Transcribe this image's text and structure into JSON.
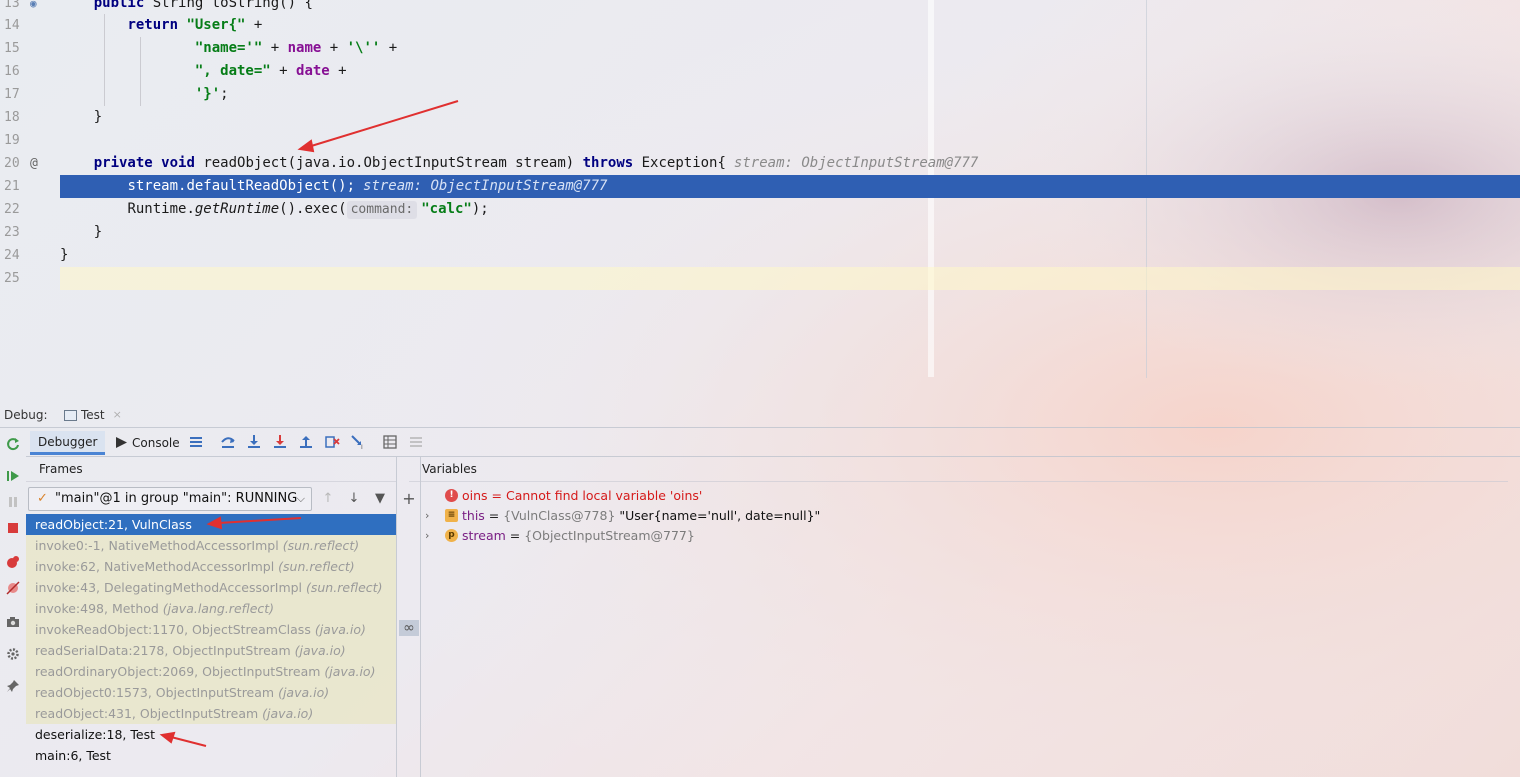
{
  "editor": {
    "lines": [
      {
        "num": "13",
        "mark": "impl"
      },
      {
        "num": "14"
      },
      {
        "num": "15"
      },
      {
        "num": "16"
      },
      {
        "num": "17"
      },
      {
        "num": "18"
      },
      {
        "num": "19"
      },
      {
        "num": "20",
        "mark": "at"
      },
      {
        "num": "21"
      },
      {
        "num": "22"
      },
      {
        "num": "23"
      },
      {
        "num": "24"
      },
      {
        "num": "25"
      }
    ],
    "code": {
      "l13": {
        "kw1": "public",
        "t1": " String ",
        "t2": "toString() {"
      },
      "l14": {
        "kw": "return",
        "str": "\"User{\"",
        "t": " +"
      },
      "l15": {
        "str1": "\"name='\"",
        "t1": " + ",
        "fld": "name",
        "t2": " + ",
        "str2": "'\\''",
        "t3": " +"
      },
      "l16": {
        "str": "\", date=\"",
        "t1": " + ",
        "fld": "date",
        "t2": " +"
      },
      "l17": {
        "str": "'}'",
        "t": ";"
      },
      "l18": {
        "t": "}"
      },
      "l20": {
        "kw1": "private",
        "kw2": "void",
        "t1": " readObject(java.io.ObjectInputStream stream) ",
        "kw3": "throws",
        "t2": " Exception{",
        "hint": "stream: ObjectInputStream@777"
      },
      "l21": {
        "t": "stream.defaultReadObject();",
        "hint": "stream: ObjectInputStream@777"
      },
      "l22": {
        "t1": "Runtime.",
        "it": "getRuntime",
        "t2": "().exec(",
        "pill": "command:",
        "str": "\"calc\"",
        "t3": ");"
      },
      "l23": {
        "t": "}"
      },
      "l24": {
        "t": "}"
      }
    }
  },
  "debug": {
    "title_label": "Debug:",
    "run_tab": "Test",
    "run_tab_close": "×",
    "tabs": {
      "debugger": "Debugger",
      "console": "Console"
    },
    "frames_header": "Frames",
    "variables_header": "Variables",
    "thread": "\"main\"@1 in group \"main\": RUNNING",
    "thread_check": "✓",
    "thread_arrow": "⌵",
    "nav": {
      "up": "↑",
      "down": "↓",
      "filter": "▼"
    },
    "add": "+",
    "watch": "∞",
    "frames": [
      {
        "text": "readObject:21, VulnClass",
        "pkg": "",
        "state": "sel"
      },
      {
        "text": "invoke0:-1, NativeMethodAccessorImpl ",
        "pkg": "(sun.reflect)",
        "state": "lib"
      },
      {
        "text": "invoke:62, NativeMethodAccessorImpl ",
        "pkg": "(sun.reflect)",
        "state": "lib"
      },
      {
        "text": "invoke:43, DelegatingMethodAccessorImpl ",
        "pkg": "(sun.reflect)",
        "state": "lib"
      },
      {
        "text": "invoke:498, Method ",
        "pkg": "(java.lang.reflect)",
        "state": "lib"
      },
      {
        "text": "invokeReadObject:1170, ObjectStreamClass ",
        "pkg": "(java.io)",
        "state": "lib"
      },
      {
        "text": "readSerialData:2178, ObjectInputStream ",
        "pkg": "(java.io)",
        "state": "lib"
      },
      {
        "text": "readOrdinaryObject:2069, ObjectInputStream ",
        "pkg": "(java.io)",
        "state": "lib"
      },
      {
        "text": "readObject0:1573, ObjectInputStream ",
        "pkg": "(java.io)",
        "state": "lib"
      },
      {
        "text": "readObject:431, ObjectInputStream ",
        "pkg": "(java.io)",
        "state": "lib"
      },
      {
        "text": "deserialize:18, Test",
        "pkg": "",
        "state": "plain"
      },
      {
        "text": "main:6, Test",
        "pkg": "",
        "state": "plain"
      }
    ],
    "variables": [
      {
        "kind": "error",
        "icon": "!",
        "text": "oins = Cannot find local variable 'oins'"
      },
      {
        "kind": "obj",
        "expand": "›",
        "name": "this",
        "eq": " = ",
        "type": "{VulnClass@778} ",
        "value": "\"User{name='null', date=null}\""
      },
      {
        "kind": "par",
        "expand": "›",
        "icon": "p",
        "name": "stream",
        "eq": " = ",
        "type": "{ObjectInputStream@777}",
        "value": ""
      }
    ]
  },
  "colors": {
    "exec_line": "#2f5fb3",
    "selected_frame": "#2f6fc0",
    "keyword": "#000080",
    "string": "#067d17",
    "field": "#871094",
    "annotation_arrow": "#e03030"
  }
}
